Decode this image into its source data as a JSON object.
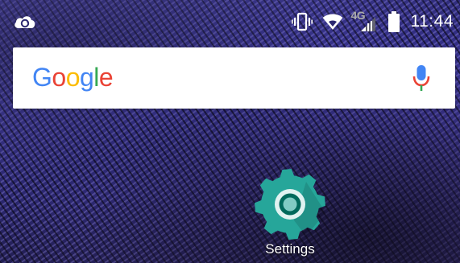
{
  "status_bar": {
    "left_icon": "cloud-sync-icon",
    "icons": [
      "vibrate-icon",
      "wifi-icon",
      "signal-icon",
      "battery-icon"
    ],
    "network_type": "4G",
    "time": "11:44"
  },
  "search_widget": {
    "logo_text": "Google",
    "logo_letters": [
      {
        "char": "G",
        "color": "#4285F4"
      },
      {
        "char": "o",
        "color": "#EA4335"
      },
      {
        "char": "o",
        "color": "#FBBC05"
      },
      {
        "char": "g",
        "color": "#4285F4"
      },
      {
        "char": "l",
        "color": "#34A853"
      },
      {
        "char": "e",
        "color": "#EA4335"
      }
    ],
    "mic_icon": "microphone-icon"
  },
  "home_screen": {
    "apps": [
      {
        "label": "Settings",
        "icon": "settings-gear-icon",
        "icon_color": "#26A69A"
      }
    ]
  }
}
